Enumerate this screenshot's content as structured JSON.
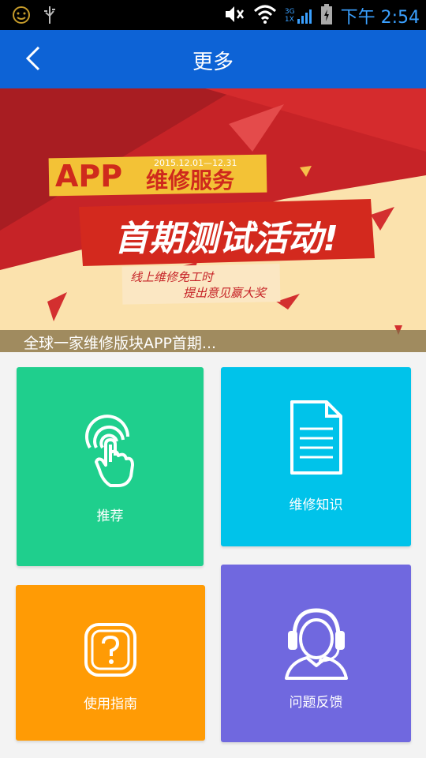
{
  "status_bar": {
    "network_labels": [
      "3G",
      "1X"
    ],
    "time": "下午 2:54",
    "icons": [
      "smiley-icon",
      "usb-icon",
      "mute-icon",
      "wifi-icon",
      "signal-icon",
      "battery-icon"
    ]
  },
  "app_bar": {
    "title": "更多",
    "back_icon": "chevron-left-icon"
  },
  "banner": {
    "headline_app": "APP",
    "headline_service": "维修服务",
    "date_range": "2015.12.01—12.31",
    "main_text": "首期测试活动!",
    "sub_line_1": "线上维修免工时",
    "sub_line_2": "提出意见赢大奖",
    "caption": "全球一家维修版块APP首期..."
  },
  "tiles": {
    "recommend": {
      "label": "推荐",
      "color": "#1fcf8d",
      "icon": "touch-icon"
    },
    "knowledge": {
      "label": "维修知识",
      "color": "#00c3ea",
      "icon": "document-icon"
    },
    "guide": {
      "label": "使用指南",
      "color": "#ff9b05",
      "icon": "question-icon"
    },
    "feedback": {
      "label": "问题反馈",
      "color": "#7068df",
      "icon": "headset-icon"
    }
  }
}
